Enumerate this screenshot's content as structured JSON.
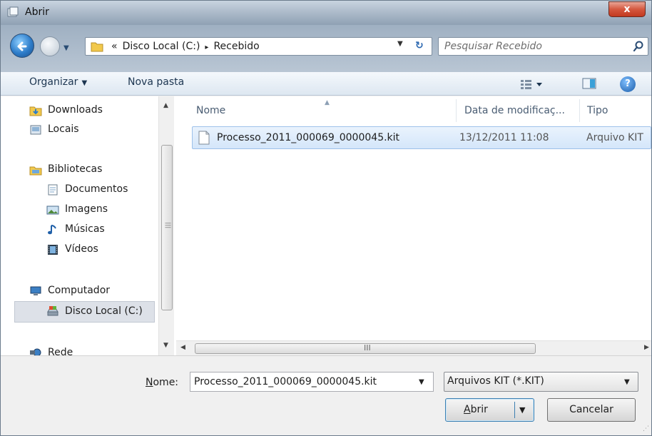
{
  "window": {
    "title": "Abrir",
    "close_label": "x"
  },
  "address": {
    "prefix": "«",
    "crumbs": [
      "Disco Local (C:)",
      "Recebido"
    ],
    "separator": "▸"
  },
  "search": {
    "placeholder": "Pesquisar Recebido"
  },
  "toolbar": {
    "organize_label": "Organizar",
    "new_folder_label": "Nova pasta"
  },
  "nav": {
    "items": [
      {
        "label": "Downloads",
        "icon": "downloads-folder-icon"
      },
      {
        "label": "Locais",
        "icon": "places-icon"
      },
      {
        "label": "Bibliotecas",
        "icon": "libraries-icon"
      },
      {
        "label": "Documentos",
        "icon": "documents-icon"
      },
      {
        "label": "Imagens",
        "icon": "pictures-icon"
      },
      {
        "label": "Músicas",
        "icon": "music-icon"
      },
      {
        "label": "Vídeos",
        "icon": "videos-icon"
      },
      {
        "label": "Computador",
        "icon": "computer-icon"
      },
      {
        "label": "Disco Local (C:)",
        "icon": "local-disk-icon",
        "selected": true
      },
      {
        "label": "Rede",
        "icon": "network-icon"
      }
    ]
  },
  "files": {
    "columns": [
      "Nome",
      "Data de modificaç...",
      "Tipo"
    ],
    "rows": [
      {
        "name": "Processo_2011_000069_0000045.kit",
        "date": "13/12/2011 11:08",
        "type": "Arquivo KIT"
      }
    ]
  },
  "scroll": {
    "grip": "III"
  },
  "footer": {
    "name_label_underlined": "N",
    "name_label_rest": "ome:",
    "name_value": "Processo_2011_000069_0000045.kit",
    "filter_value": "Arquivos KIT (*.KIT)",
    "open_underlined": "A",
    "open_rest": "brir",
    "cancel_label": "Cancelar"
  },
  "colors": {
    "accent": "#2d7cc9",
    "selection": "#d4e6fa",
    "close_red": "#c2391f"
  }
}
